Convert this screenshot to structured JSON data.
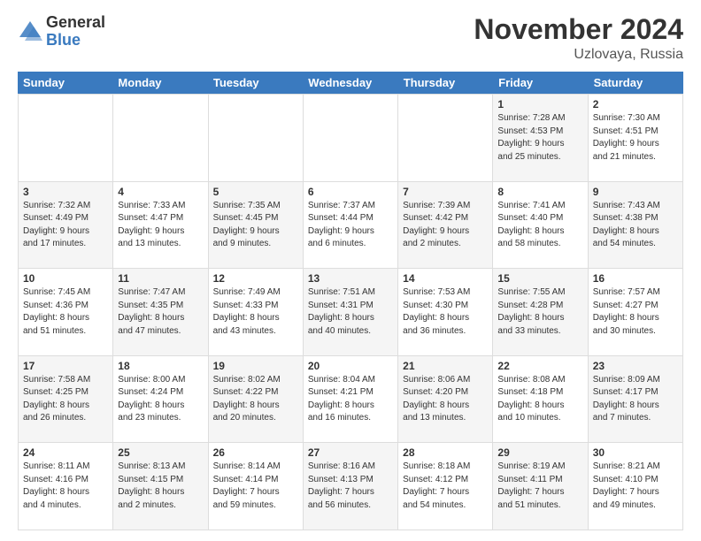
{
  "header": {
    "logo_general": "General",
    "logo_blue": "Blue",
    "month_title": "November 2024",
    "location": "Uzlovaya, Russia"
  },
  "weekdays": [
    "Sunday",
    "Monday",
    "Tuesday",
    "Wednesday",
    "Thursday",
    "Friday",
    "Saturday"
  ],
  "rows": [
    [
      {
        "day": "",
        "info": ""
      },
      {
        "day": "",
        "info": ""
      },
      {
        "day": "",
        "info": ""
      },
      {
        "day": "",
        "info": ""
      },
      {
        "day": "",
        "info": ""
      },
      {
        "day": "1",
        "info": "Sunrise: 7:28 AM\nSunset: 4:53 PM\nDaylight: 9 hours\nand 25 minutes."
      },
      {
        "day": "2",
        "info": "Sunrise: 7:30 AM\nSunset: 4:51 PM\nDaylight: 9 hours\nand 21 minutes."
      }
    ],
    [
      {
        "day": "3",
        "info": "Sunrise: 7:32 AM\nSunset: 4:49 PM\nDaylight: 9 hours\nand 17 minutes."
      },
      {
        "day": "4",
        "info": "Sunrise: 7:33 AM\nSunset: 4:47 PM\nDaylight: 9 hours\nand 13 minutes."
      },
      {
        "day": "5",
        "info": "Sunrise: 7:35 AM\nSunset: 4:45 PM\nDaylight: 9 hours\nand 9 minutes."
      },
      {
        "day": "6",
        "info": "Sunrise: 7:37 AM\nSunset: 4:44 PM\nDaylight: 9 hours\nand 6 minutes."
      },
      {
        "day": "7",
        "info": "Sunrise: 7:39 AM\nSunset: 4:42 PM\nDaylight: 9 hours\nand 2 minutes."
      },
      {
        "day": "8",
        "info": "Sunrise: 7:41 AM\nSunset: 4:40 PM\nDaylight: 8 hours\nand 58 minutes."
      },
      {
        "day": "9",
        "info": "Sunrise: 7:43 AM\nSunset: 4:38 PM\nDaylight: 8 hours\nand 54 minutes."
      }
    ],
    [
      {
        "day": "10",
        "info": "Sunrise: 7:45 AM\nSunset: 4:36 PM\nDaylight: 8 hours\nand 51 minutes."
      },
      {
        "day": "11",
        "info": "Sunrise: 7:47 AM\nSunset: 4:35 PM\nDaylight: 8 hours\nand 47 minutes."
      },
      {
        "day": "12",
        "info": "Sunrise: 7:49 AM\nSunset: 4:33 PM\nDaylight: 8 hours\nand 43 minutes."
      },
      {
        "day": "13",
        "info": "Sunrise: 7:51 AM\nSunset: 4:31 PM\nDaylight: 8 hours\nand 40 minutes."
      },
      {
        "day": "14",
        "info": "Sunrise: 7:53 AM\nSunset: 4:30 PM\nDaylight: 8 hours\nand 36 minutes."
      },
      {
        "day": "15",
        "info": "Sunrise: 7:55 AM\nSunset: 4:28 PM\nDaylight: 8 hours\nand 33 minutes."
      },
      {
        "day": "16",
        "info": "Sunrise: 7:57 AM\nSunset: 4:27 PM\nDaylight: 8 hours\nand 30 minutes."
      }
    ],
    [
      {
        "day": "17",
        "info": "Sunrise: 7:58 AM\nSunset: 4:25 PM\nDaylight: 8 hours\nand 26 minutes."
      },
      {
        "day": "18",
        "info": "Sunrise: 8:00 AM\nSunset: 4:24 PM\nDaylight: 8 hours\nand 23 minutes."
      },
      {
        "day": "19",
        "info": "Sunrise: 8:02 AM\nSunset: 4:22 PM\nDaylight: 8 hours\nand 20 minutes."
      },
      {
        "day": "20",
        "info": "Sunrise: 8:04 AM\nSunset: 4:21 PM\nDaylight: 8 hours\nand 16 minutes."
      },
      {
        "day": "21",
        "info": "Sunrise: 8:06 AM\nSunset: 4:20 PM\nDaylight: 8 hours\nand 13 minutes."
      },
      {
        "day": "22",
        "info": "Sunrise: 8:08 AM\nSunset: 4:18 PM\nDaylight: 8 hours\nand 10 minutes."
      },
      {
        "day": "23",
        "info": "Sunrise: 8:09 AM\nSunset: 4:17 PM\nDaylight: 8 hours\nand 7 minutes."
      }
    ],
    [
      {
        "day": "24",
        "info": "Sunrise: 8:11 AM\nSunset: 4:16 PM\nDaylight: 8 hours\nand 4 minutes."
      },
      {
        "day": "25",
        "info": "Sunrise: 8:13 AM\nSunset: 4:15 PM\nDaylight: 8 hours\nand 2 minutes."
      },
      {
        "day": "26",
        "info": "Sunrise: 8:14 AM\nSunset: 4:14 PM\nDaylight: 7 hours\nand 59 minutes."
      },
      {
        "day": "27",
        "info": "Sunrise: 8:16 AM\nSunset: 4:13 PM\nDaylight: 7 hours\nand 56 minutes."
      },
      {
        "day": "28",
        "info": "Sunrise: 8:18 AM\nSunset: 4:12 PM\nDaylight: 7 hours\nand 54 minutes."
      },
      {
        "day": "29",
        "info": "Sunrise: 8:19 AM\nSunset: 4:11 PM\nDaylight: 7 hours\nand 51 minutes."
      },
      {
        "day": "30",
        "info": "Sunrise: 8:21 AM\nSunset: 4:10 PM\nDaylight: 7 hours\nand 49 minutes."
      }
    ]
  ]
}
